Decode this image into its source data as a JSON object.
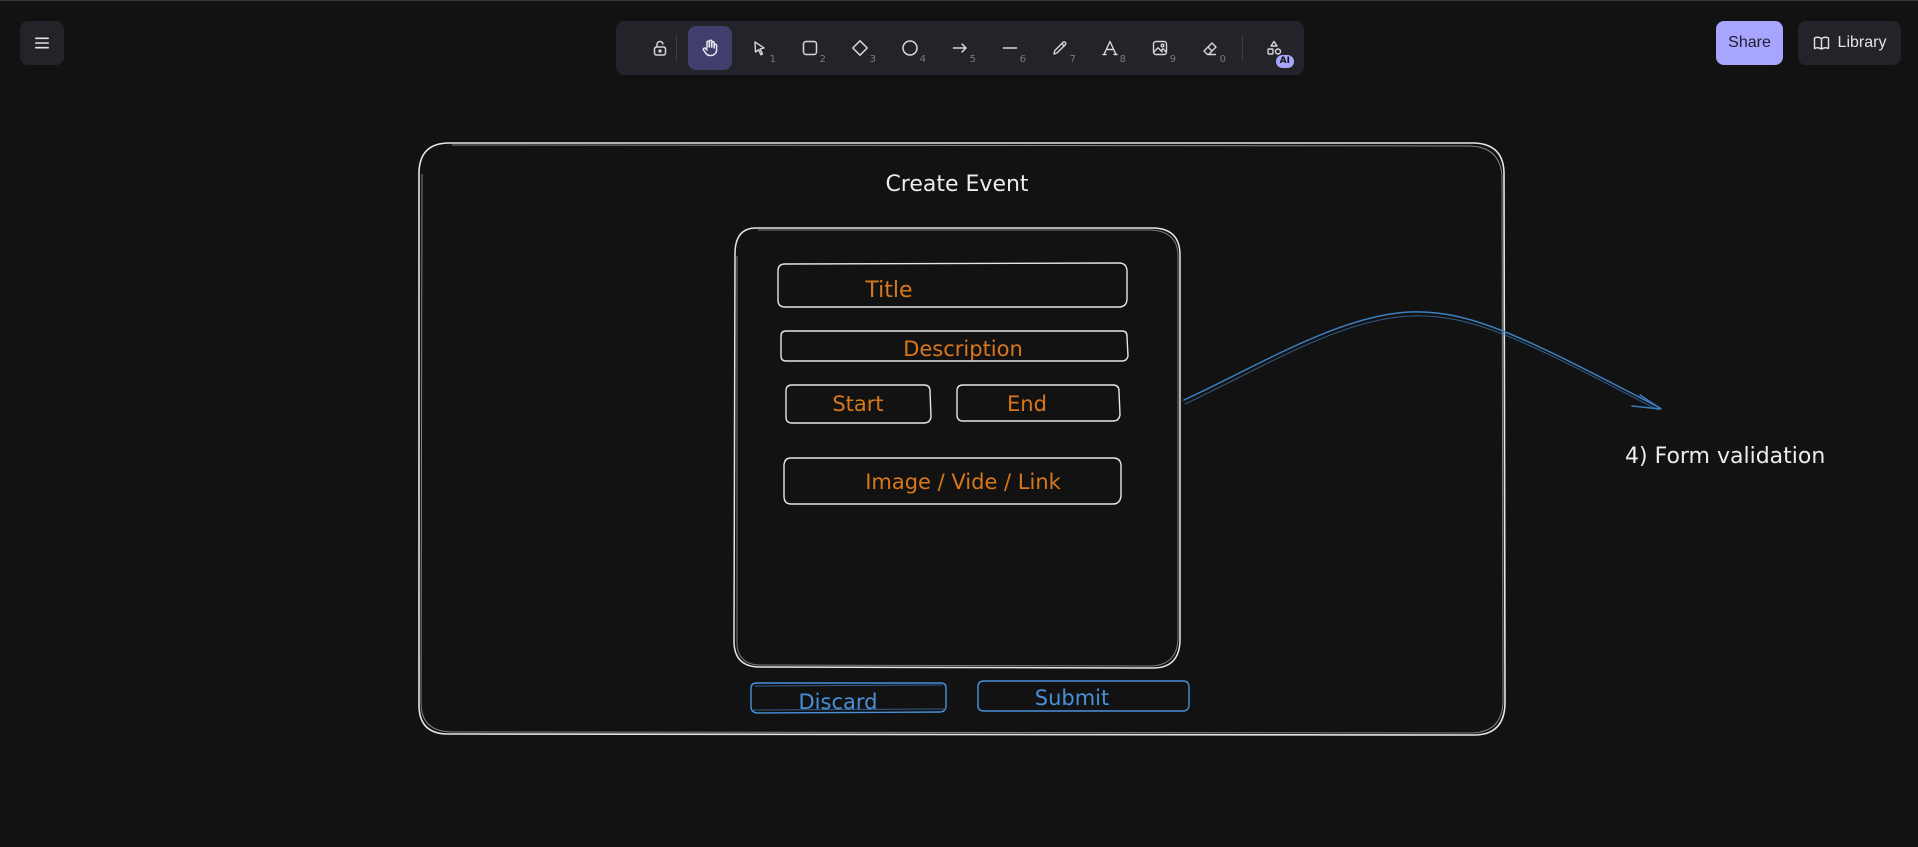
{
  "app": {
    "share_label": "Share",
    "library_label": "Library"
  },
  "toolbar": {
    "tools": [
      {
        "name": "lock-icon",
        "shortcut": ""
      },
      {
        "name": "hand-icon",
        "shortcut": ""
      },
      {
        "name": "selection-icon",
        "shortcut": "1"
      },
      {
        "name": "rectangle-icon",
        "shortcut": "2"
      },
      {
        "name": "diamond-icon",
        "shortcut": "3"
      },
      {
        "name": "ellipse-icon",
        "shortcut": "4"
      },
      {
        "name": "arrow-icon",
        "shortcut": "5"
      },
      {
        "name": "line-icon",
        "shortcut": "6"
      },
      {
        "name": "pencil-icon",
        "shortcut": "7"
      },
      {
        "name": "text-icon",
        "shortcut": "8"
      },
      {
        "name": "image-icon",
        "shortcut": "9"
      },
      {
        "name": "eraser-icon",
        "shortcut": "0"
      },
      {
        "name": "shapes-icon",
        "shortcut": ""
      }
    ],
    "active_tool": "hand-icon",
    "ai_badge": "AI"
  },
  "canvas": {
    "frame_title": "Create Event",
    "fields": {
      "title": "Title",
      "description": "Description",
      "start": "Start",
      "end": "End",
      "media": "Image / Vide / Link"
    },
    "buttons": {
      "discard": "Discard",
      "submit": "Submit"
    },
    "note": "4) Form validation",
    "colors": {
      "stroke": "#e6e6e6",
      "field_text": "#d9781a",
      "button_text": "#4a90d9",
      "arrow": "#3d7fc0",
      "accent": "#a8a5ff"
    }
  }
}
